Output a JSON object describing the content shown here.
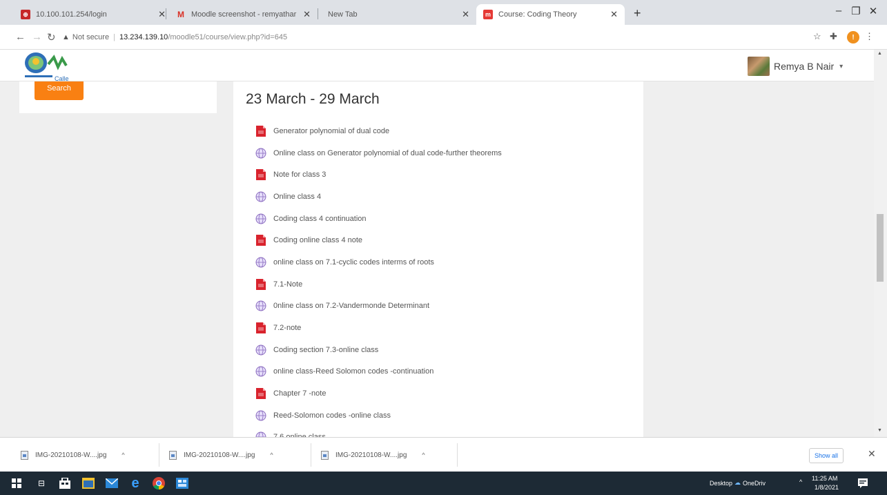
{
  "browser": {
    "tabs": [
      {
        "title": "10.100.101.254/login",
        "favicon": "globe-red-icon",
        "active": false
      },
      {
        "title": "Moodle screenshot - remyathar",
        "favicon": "gmail-icon",
        "active": false
      },
      {
        "title": "New Tab",
        "favicon": "",
        "active": false
      },
      {
        "title": "Course: Coding Theory",
        "favicon": "moodle-icon",
        "active": true
      }
    ],
    "new_tab": "+",
    "address": {
      "security_label": "Not secure",
      "host": "13.234.139.10",
      "path": "/moodle51/course/view.php?id=645"
    },
    "profile_initial": "!"
  },
  "site": {
    "logo_text": "Calle",
    "user_name": "Remya B Nair",
    "search_button": "Search"
  },
  "course": {
    "section_title": "23 March - 29 March",
    "activities": [
      {
        "label": "Generator polynomial of dual code",
        "type": "pdf"
      },
      {
        "label": "Online class on Generator polynomial of dual code-further theorems",
        "type": "url"
      },
      {
        "label": "Note for class 3",
        "type": "pdf"
      },
      {
        "label": "Online class 4",
        "type": "url"
      },
      {
        "label": "Coding class 4 continuation",
        "type": "url"
      },
      {
        "label": "Coding online class 4 note",
        "type": "pdf"
      },
      {
        "label": "online class on 7.1-cyclic codes interms of roots",
        "type": "url"
      },
      {
        "label": "7.1-Note",
        "type": "pdf"
      },
      {
        "label": "0nline class on 7.2-Vandermonde Determinant",
        "type": "url"
      },
      {
        "label": "7.2-note",
        "type": "pdf"
      },
      {
        "label": "Coding section 7.3-online class",
        "type": "url"
      },
      {
        "label": "online class-Reed Solomon codes -continuation",
        "type": "url"
      },
      {
        "label": "Chapter 7 -note",
        "type": "pdf"
      },
      {
        "label": "Reed-Solomon codes -online class",
        "type": "url"
      },
      {
        "label": "7.6 online class",
        "type": "url"
      }
    ]
  },
  "downloads": {
    "items": [
      {
        "name": "IMG-20210108-W....jpg"
      },
      {
        "name": "IMG-20210108-W....jpg"
      },
      {
        "name": "IMG-20210108-W....jpg"
      }
    ],
    "show_all": "Show all"
  },
  "taskbar": {
    "desktop_label": "Desktop",
    "onedrive_label": "OneDriv",
    "time": "11:25 AM",
    "date": "1/8/2021"
  },
  "colors": {
    "accent_orange": "#f98012",
    "pdf_red": "#d9232d",
    "url_purple": "#8a6bbf",
    "taskbar": "#1d2a35"
  }
}
